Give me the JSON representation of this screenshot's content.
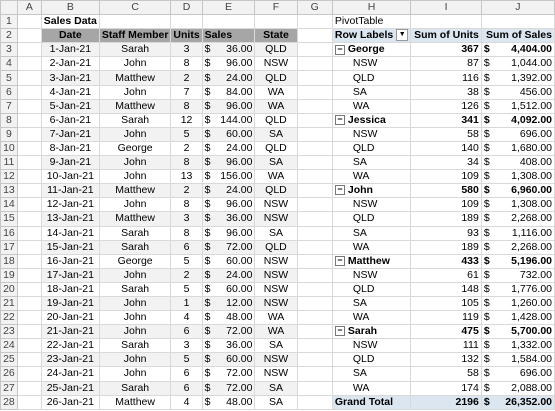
{
  "columns": [
    "A",
    "B",
    "C",
    "D",
    "E",
    "F",
    "G",
    "H",
    "I",
    "J"
  ],
  "sales": {
    "title": "Sales Data",
    "headers": [
      "Date",
      "Staff Member",
      "Units",
      "Sales",
      "State"
    ],
    "currency": "$",
    "rows": [
      [
        "1-Jan-21",
        "Sarah",
        "3",
        "36.00",
        "QLD"
      ],
      [
        "2-Jan-21",
        "John",
        "8",
        "96.00",
        "NSW"
      ],
      [
        "3-Jan-21",
        "Matthew",
        "2",
        "24.00",
        "QLD"
      ],
      [
        "4-Jan-21",
        "John",
        "7",
        "84.00",
        "WA"
      ],
      [
        "5-Jan-21",
        "Matthew",
        "8",
        "96.00",
        "WA"
      ],
      [
        "6-Jan-21",
        "Sarah",
        "12",
        "144.00",
        "QLD"
      ],
      [
        "7-Jan-21",
        "John",
        "5",
        "60.00",
        "SA"
      ],
      [
        "8-Jan-21",
        "George",
        "2",
        "24.00",
        "QLD"
      ],
      [
        "9-Jan-21",
        "John",
        "8",
        "96.00",
        "SA"
      ],
      [
        "10-Jan-21",
        "John",
        "13",
        "156.00",
        "WA"
      ],
      [
        "11-Jan-21",
        "Matthew",
        "2",
        "24.00",
        "QLD"
      ],
      [
        "12-Jan-21",
        "John",
        "8",
        "96.00",
        "NSW"
      ],
      [
        "13-Jan-21",
        "Matthew",
        "3",
        "36.00",
        "NSW"
      ],
      [
        "14-Jan-21",
        "Sarah",
        "8",
        "96.00",
        "SA"
      ],
      [
        "15-Jan-21",
        "Sarah",
        "6",
        "72.00",
        "QLD"
      ],
      [
        "16-Jan-21",
        "George",
        "5",
        "60.00",
        "NSW"
      ],
      [
        "17-Jan-21",
        "John",
        "2",
        "24.00",
        "NSW"
      ],
      [
        "18-Jan-21",
        "Sarah",
        "5",
        "60.00",
        "NSW"
      ],
      [
        "19-Jan-21",
        "John",
        "1",
        "12.00",
        "NSW"
      ],
      [
        "20-Jan-21",
        "John",
        "4",
        "48.00",
        "WA"
      ],
      [
        "21-Jan-21",
        "John",
        "6",
        "72.00",
        "WA"
      ],
      [
        "22-Jan-21",
        "Sarah",
        "3",
        "36.00",
        "SA"
      ],
      [
        "23-Jan-21",
        "John",
        "5",
        "60.00",
        "NSW"
      ],
      [
        "24-Jan-21",
        "John",
        "6",
        "72.00",
        "NSW"
      ],
      [
        "25-Jan-21",
        "Sarah",
        "6",
        "72.00",
        "SA"
      ],
      [
        "26-Jan-21",
        "Matthew",
        "4",
        "48.00",
        "SA"
      ]
    ]
  },
  "pivot": {
    "title": "PivotTable",
    "headers": [
      "Row Labels",
      "Sum of Units",
      "Sum of Sales"
    ],
    "dropdown_glyph": "▼",
    "collapse_glyph": "−",
    "rows": [
      {
        "type": "group",
        "label": "George",
        "units": "367",
        "sales": "4,404.00"
      },
      {
        "type": "item",
        "label": "NSW",
        "units": "87",
        "sales": "1,044.00"
      },
      {
        "type": "item",
        "label": "QLD",
        "units": "116",
        "sales": "1,392.00"
      },
      {
        "type": "item",
        "label": "SA",
        "units": "38",
        "sales": "456.00"
      },
      {
        "type": "item",
        "label": "WA",
        "units": "126",
        "sales": "1,512.00"
      },
      {
        "type": "group",
        "label": "Jessica",
        "units": "341",
        "sales": "4,092.00"
      },
      {
        "type": "item",
        "label": "NSW",
        "units": "58",
        "sales": "696.00"
      },
      {
        "type": "item",
        "label": "QLD",
        "units": "140",
        "sales": "1,680.00"
      },
      {
        "type": "item",
        "label": "SA",
        "units": "34",
        "sales": "408.00"
      },
      {
        "type": "item",
        "label": "WA",
        "units": "109",
        "sales": "1,308.00"
      },
      {
        "type": "group",
        "label": "John",
        "units": "580",
        "sales": "6,960.00"
      },
      {
        "type": "item",
        "label": "NSW",
        "units": "109",
        "sales": "1,308.00"
      },
      {
        "type": "item",
        "label": "QLD",
        "units": "189",
        "sales": "2,268.00"
      },
      {
        "type": "item",
        "label": "SA",
        "units": "93",
        "sales": "1,116.00"
      },
      {
        "type": "item",
        "label": "WA",
        "units": "189",
        "sales": "2,268.00"
      },
      {
        "type": "group",
        "label": "Matthew",
        "units": "433",
        "sales": "5,196.00"
      },
      {
        "type": "item",
        "label": "NSW",
        "units": "61",
        "sales": "732.00"
      },
      {
        "type": "item",
        "label": "QLD",
        "units": "148",
        "sales": "1,776.00"
      },
      {
        "type": "item",
        "label": "SA",
        "units": "105",
        "sales": "1,260.00"
      },
      {
        "type": "item",
        "label": "WA",
        "units": "119",
        "sales": "1,428.00"
      },
      {
        "type": "group",
        "label": "Sarah",
        "units": "475",
        "sales": "5,700.00"
      },
      {
        "type": "item",
        "label": "NSW",
        "units": "111",
        "sales": "1,332.00"
      },
      {
        "type": "item",
        "label": "QLD",
        "units": "132",
        "sales": "1,584.00"
      },
      {
        "type": "item",
        "label": "SA",
        "units": "58",
        "sales": "696.00"
      },
      {
        "type": "item",
        "label": "WA",
        "units": "174",
        "sales": "2,088.00"
      },
      {
        "type": "total",
        "label": "Grand Total",
        "units": "2196",
        "sales": "26,352.00"
      }
    ]
  }
}
